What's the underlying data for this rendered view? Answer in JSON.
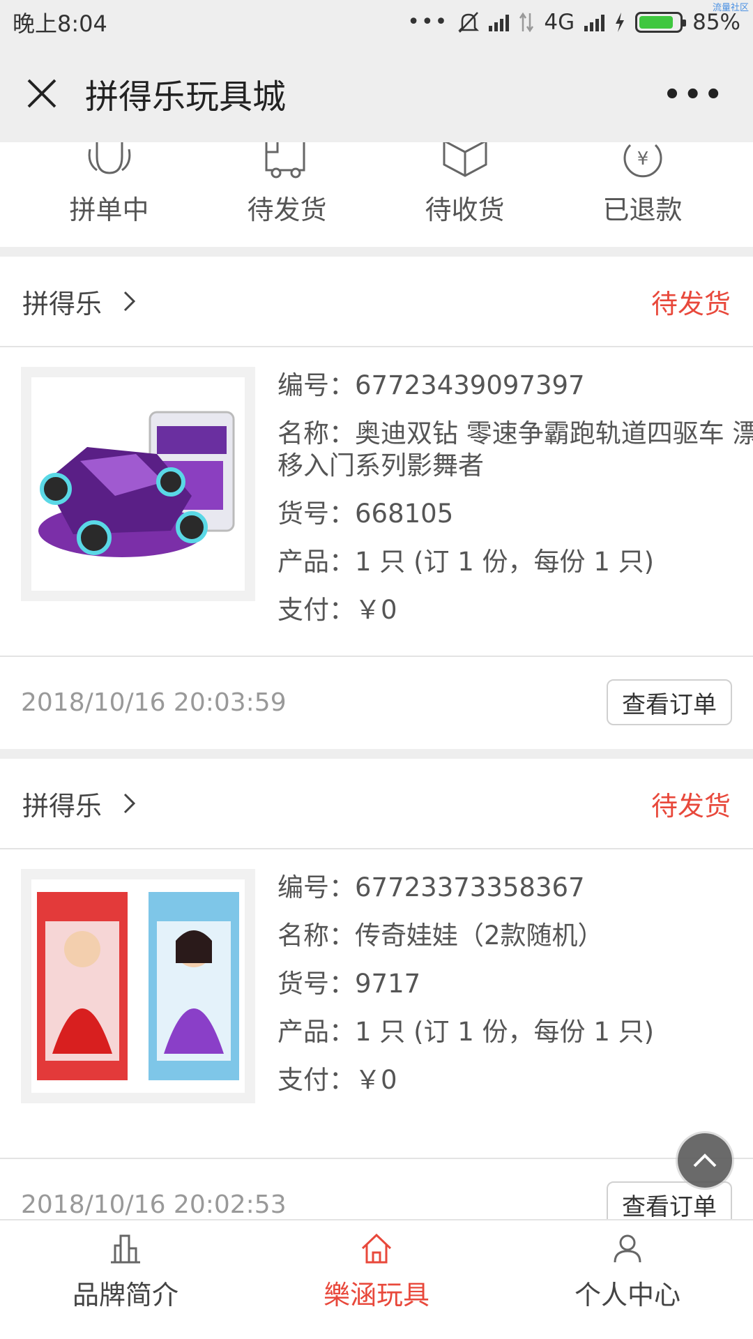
{
  "status_bar": {
    "time": "晚上8:04",
    "dots": "•••",
    "network": "4G",
    "battery_pct": "85%",
    "watermark": "流量社区"
  },
  "header": {
    "title": "拼得乐玩具城",
    "close_icon": "close-icon",
    "more_label": "•••"
  },
  "order_tabs": [
    {
      "label": "拼单中",
      "icon": "shirt-icon"
    },
    {
      "label": "待发货",
      "icon": "truck-icon"
    },
    {
      "label": "待收货",
      "icon": "box-icon"
    },
    {
      "label": "已退款",
      "icon": "yuan-refund-icon"
    }
  ],
  "orders": [
    {
      "shop": "拼得乐",
      "status": "待发货",
      "number": "编号：67723439097397",
      "name": "名称：奥迪双钻 零速争霸跑轨道四驱车 漂移入门系列影舞者",
      "sku": "货号：668105",
      "product": "产品：1 只 (订 1 份，每份 1 只)",
      "payment": "支付：￥0",
      "time": "2018/10/16 20:03:59",
      "view_label": "查看订单"
    },
    {
      "shop": "拼得乐",
      "status": "待发货",
      "number": "编号：67723373358367",
      "name": "名称：传奇娃娃（2款随机）",
      "sku": "货号：9717",
      "product": "产品：1 只 (订 1 份，每份 1 只)",
      "payment": "支付：￥0",
      "time": "2018/10/16 20:02:53",
      "view_label": "查看订单"
    }
  ],
  "bottom_nav": [
    {
      "label": "品牌简介",
      "icon": "building-icon",
      "active": false
    },
    {
      "label": "樂涵玩具",
      "icon": "home-icon",
      "active": true
    },
    {
      "label": "个人中心",
      "icon": "user-icon",
      "active": false
    }
  ],
  "colors": {
    "accent": "#e8483b",
    "bar_bg": "#eeeeee",
    "battery": "#3fc73f"
  }
}
